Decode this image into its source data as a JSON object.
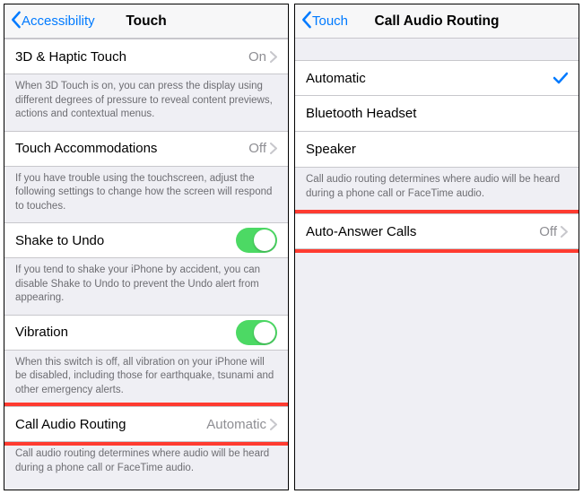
{
  "left": {
    "nav": {
      "back": "Accessibility",
      "title": "Touch"
    },
    "rows": {
      "r3d": {
        "label": "3D & Haptic Touch",
        "value": "On"
      },
      "r3d_footer": "When 3D Touch is on, you can press the display using different degrees of pressure to reveal content previews, actions and contextual menus.",
      "accom": {
        "label": "Touch Accommodations",
        "value": "Off"
      },
      "accom_footer": "If you have trouble using the touchscreen, adjust the following settings to change how the screen will respond to touches.",
      "shake": {
        "label": "Shake to Undo"
      },
      "shake_footer": "If you tend to shake your iPhone by accident, you can disable Shake to Undo to prevent the Undo alert from appearing.",
      "vib": {
        "label": "Vibration"
      },
      "vib_footer": "When this switch is off, all vibration on your iPhone will be disabled, including those for earthquake, tsunami and other emergency alerts.",
      "car": {
        "label": "Call Audio Routing",
        "value": "Automatic"
      },
      "car_footer": "Call audio routing determines where audio will be heard during a phone call or FaceTime audio."
    }
  },
  "right": {
    "nav": {
      "back": "Touch",
      "title": "Call Audio Routing"
    },
    "options": {
      "auto": "Automatic",
      "bt": "Bluetooth Headset",
      "spk": "Speaker"
    },
    "options_footer": "Call audio routing determines where audio will be heard during a phone call or FaceTime audio.",
    "auto_answer": {
      "label": "Auto-Answer Calls",
      "value": "Off"
    }
  }
}
